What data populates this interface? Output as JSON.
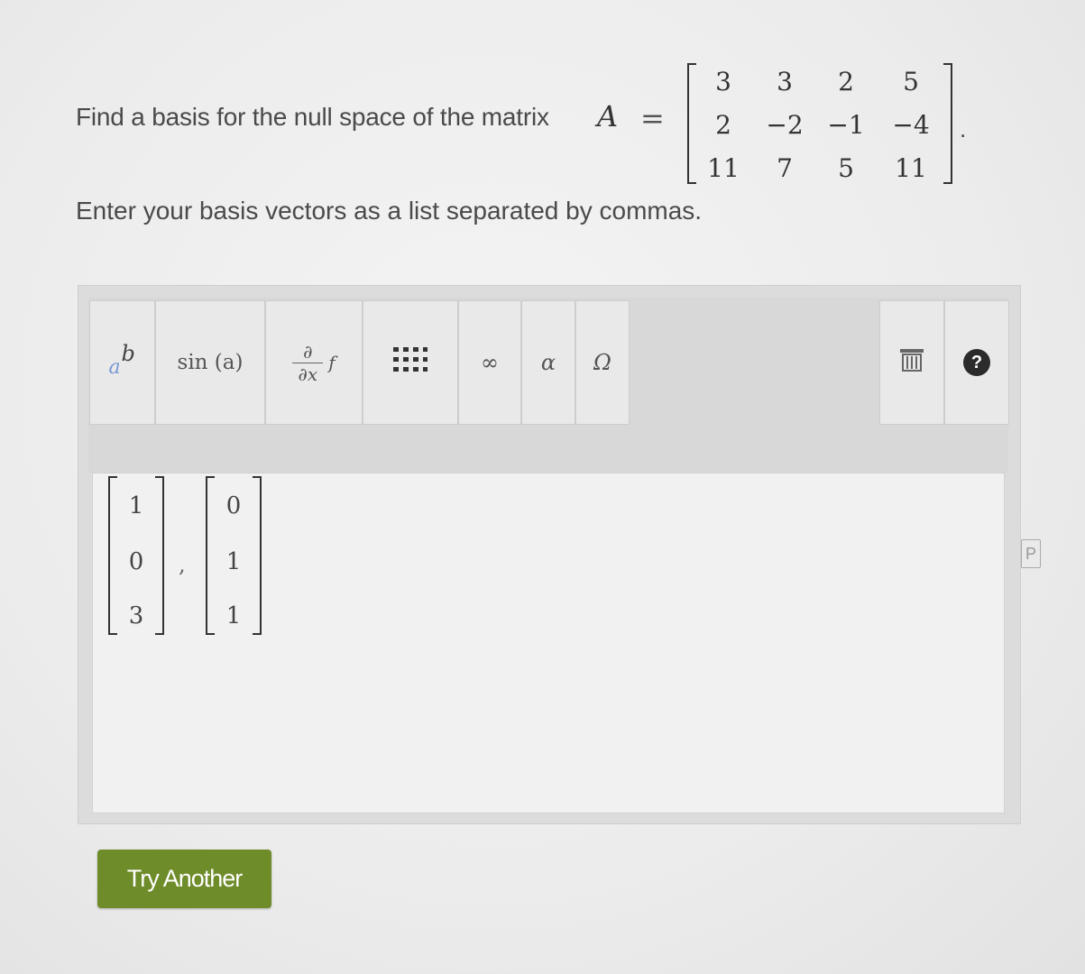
{
  "question": {
    "text": "Find a basis for the null space of the matrix",
    "variable": "A",
    "equals": "=",
    "period": ".",
    "matrix": [
      [
        "3",
        "3",
        "2",
        "5"
      ],
      [
        "2",
        "−2",
        "−1",
        "−4"
      ],
      [
        "11",
        "7",
        "5",
        "11"
      ]
    ]
  },
  "instruction": "Enter your basis vectors as a list separated by commas.",
  "toolbar": {
    "buttons": [
      {
        "name": "superscript",
        "label_base": "a",
        "label_sup": "b"
      },
      {
        "name": "functions",
        "label": "sin (a)"
      },
      {
        "name": "calculus",
        "label_num": "∂",
        "label_den": "∂x",
        "label_f": "f"
      },
      {
        "name": "matrix",
        "icon": "matrix-grid-icon"
      },
      {
        "name": "infinity",
        "label": "∞"
      },
      {
        "name": "greek",
        "label": "α"
      },
      {
        "name": "symbols",
        "label": "Ω"
      }
    ],
    "right": [
      {
        "name": "delete",
        "icon": "trash-icon"
      },
      {
        "name": "help",
        "label": "?"
      }
    ]
  },
  "answer": {
    "vectors": [
      [
        "1",
        "0",
        "3"
      ],
      [
        "0",
        "1",
        "1"
      ]
    ],
    "separator": ","
  },
  "try_another_label": "Try Another",
  "side_icon_label": "P"
}
